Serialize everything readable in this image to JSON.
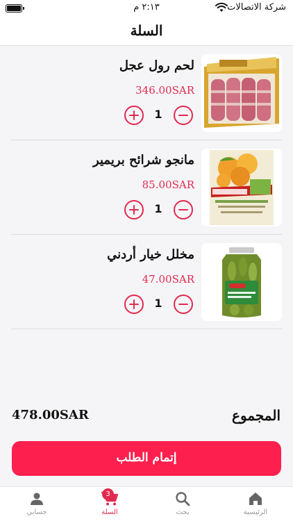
{
  "status_bar": {
    "carrier": "شركة الاتصالات",
    "time": "٢:١٣ م"
  },
  "header": {
    "title": "السلة"
  },
  "cart": {
    "items": [
      {
        "name": "لحم رول عجل",
        "price": "346.00SAR",
        "quantity": "1"
      },
      {
        "name": "مانجو شرائح بريمير",
        "price": "85.00SAR",
        "quantity": "1"
      },
      {
        "name": "مخلل خيار أردني",
        "price": "47.00SAR",
        "quantity": "1"
      }
    ]
  },
  "summary": {
    "total_label": "المجموع",
    "total_value": "478.00SAR"
  },
  "checkout": {
    "label": "إتمام الطلب"
  },
  "tab_bar": {
    "tabs": [
      {
        "label": "حسابي",
        "icon": "person-icon"
      },
      {
        "label": "السلة",
        "icon": "cart-icon",
        "badge": "3"
      },
      {
        "label": "بحث",
        "icon": "search-icon"
      },
      {
        "label": "الرئيسية",
        "icon": "home-icon"
      }
    ],
    "active_color": "#e22a4f"
  },
  "colors": {
    "accent": "#fd1f4d",
    "price": "#e22a4f"
  }
}
